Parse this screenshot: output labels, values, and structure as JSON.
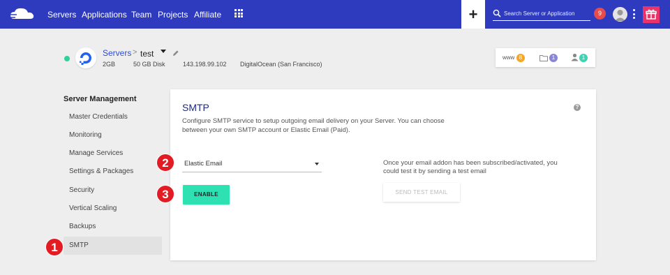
{
  "nav": {
    "items": [
      "Servers",
      "Applications",
      "Team",
      "Projects",
      "Affiliate"
    ],
    "plus_label": "+",
    "search_placeholder": "Search Server or Application",
    "notifications": "9"
  },
  "server": {
    "breadcrumb_root": "Servers",
    "breadcrumb_sep": ">",
    "name": "test",
    "ram": "2GB",
    "disk": "50 GB Disk",
    "ip": "143.198.99.102",
    "provider": "DigitalOcean (San Francisco)"
  },
  "counts": {
    "www_label": "www",
    "www": "8",
    "folders": "1",
    "users": "1"
  },
  "colors": {
    "nav_bg": "#2f3bbf",
    "accent_green": "#2ee1b2",
    "step_red": "#e31b23",
    "badge_orange": "#f5a623",
    "badge_purple": "#8a86d6",
    "badge_teal": "#3ed3b3"
  },
  "sidebar": {
    "title": "Server Management",
    "items": [
      "Master Credentials",
      "Monitoring",
      "Manage Services",
      "Settings & Packages",
      "Security",
      "Vertical Scaling",
      "Backups",
      "SMTP"
    ],
    "active": "SMTP"
  },
  "smtp": {
    "title": "SMTP",
    "help": "?",
    "description_line1": "Configure SMTP service to setup outgoing email delivery on your Server. You can choose",
    "description_line2": "between your own SMTP account or Elastic Email (Paid).",
    "select_value": "Elastic Email",
    "enable_label": "ENABLE",
    "test_note_line1": "Once your email addon has been subscribed/activated, you",
    "test_note_line2": "could test it by sending a test email",
    "test_button": "SEND TEST EMAIL"
  },
  "steps": [
    "1",
    "2",
    "3"
  ]
}
